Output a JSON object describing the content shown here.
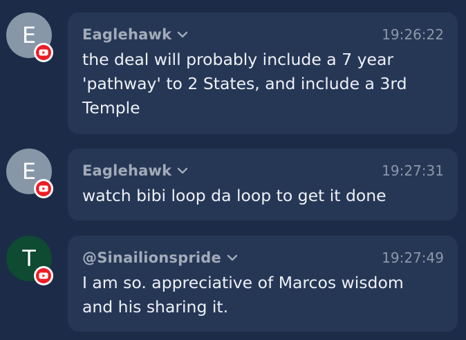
{
  "colors": {
    "background": "#1c2b47",
    "bubble": "#263756",
    "avatar_e": "#8797a8",
    "avatar_t": "#0f4a33",
    "youtube_red": "#ee1c24"
  },
  "messages": [
    {
      "avatar_letter": "E",
      "author": "Eaglehawk",
      "time": "19:26:22",
      "text": "the deal will probably include a 7 year\n'pathway' to 2 States, and include a 3rd\nTemple",
      "source_icon": "youtube-icon"
    },
    {
      "avatar_letter": "E",
      "author": "Eaglehawk",
      "time": "19:27:31",
      "text": "watch bibi loop da loop to get it done",
      "source_icon": "youtube-icon"
    },
    {
      "avatar_letter": "T",
      "author": "@Sinailionspride",
      "time": "19:27:49",
      "text": "I am so. appreciative of Marcos wisdom\nand his sharing it.",
      "source_icon": "youtube-icon"
    }
  ]
}
